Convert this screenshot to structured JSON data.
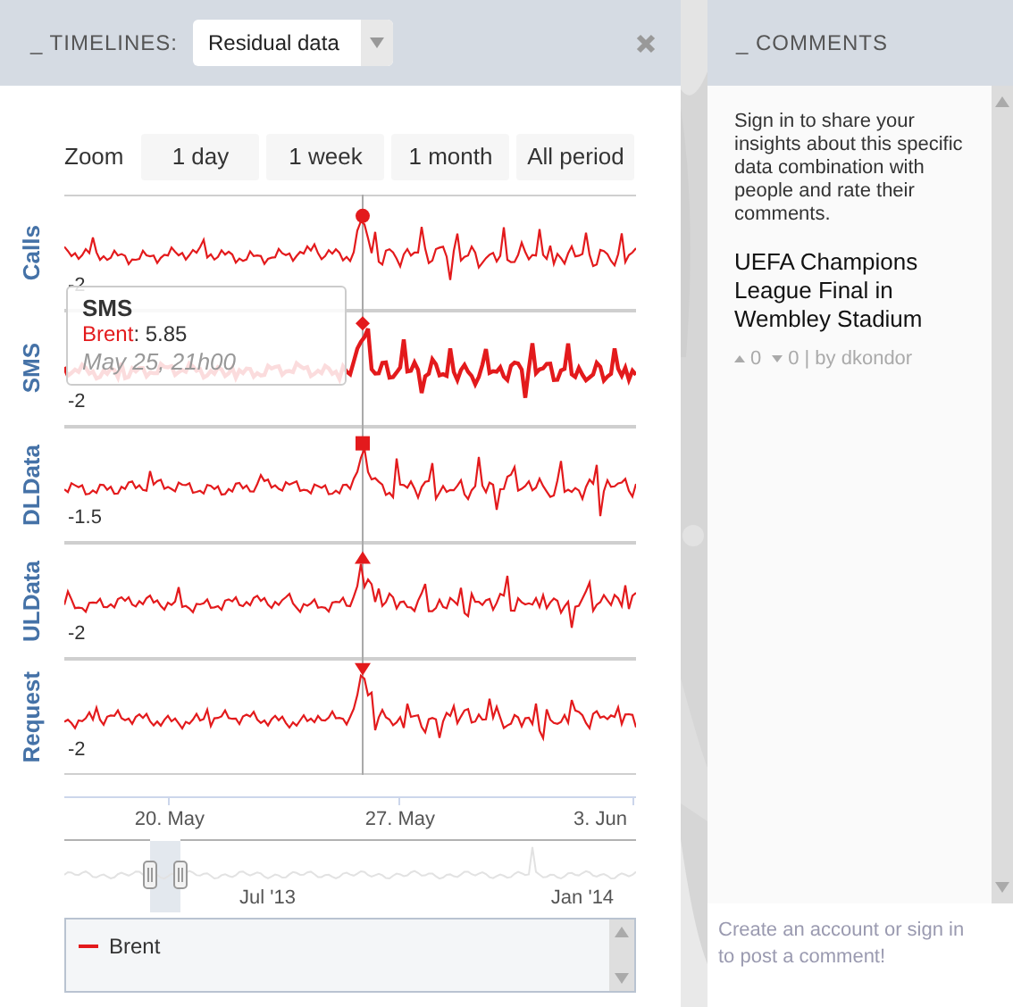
{
  "timelines": {
    "title": "_ TIMELINES:",
    "dataset": "Residual data"
  },
  "zoom": {
    "label": "Zoom",
    "buttons": [
      "1 day",
      "1 week",
      "1 month",
      "All period"
    ]
  },
  "series": [
    {
      "name": "Calls",
      "min_label": "-2",
      "kind": "circle",
      "highlighted": false
    },
    {
      "name": "SMS",
      "min_label": "-2",
      "kind": "diamond",
      "highlighted": true
    },
    {
      "name": "DLData",
      "min_label": "-1.5",
      "kind": "square",
      "highlighted": false
    },
    {
      "name": "ULData",
      "min_label": "-2",
      "kind": "triangle",
      "highlighted": false
    },
    {
      "name": "Request",
      "min_label": "-2",
      "kind": "triangle-down",
      "highlighted": false
    }
  ],
  "tooltip": {
    "title": "SMS",
    "series": "Brent",
    "separator": ":",
    "color": "#e31a1c",
    "value": "5.85",
    "date": "May 25, 21h00"
  },
  "x_axis": [
    "20. May",
    "27. May",
    "3. Jun"
  ],
  "navigator": {
    "labels": [
      "Jul '13",
      "Jan '14"
    ]
  },
  "legend": [
    {
      "name": "Brent",
      "color": "#e31a1c"
    }
  ],
  "comments": {
    "title": "_ COMMENTS",
    "intro": "Sign in to share your insights about this specific data combination with people and rate their comments.",
    "items": [
      {
        "title": "UEFA Champions League Final in Wembley Stadium",
        "up": "0",
        "down": "0",
        "author": "| by dkondor"
      }
    ],
    "footer": "Create an account or sign in to post a comment!"
  }
}
